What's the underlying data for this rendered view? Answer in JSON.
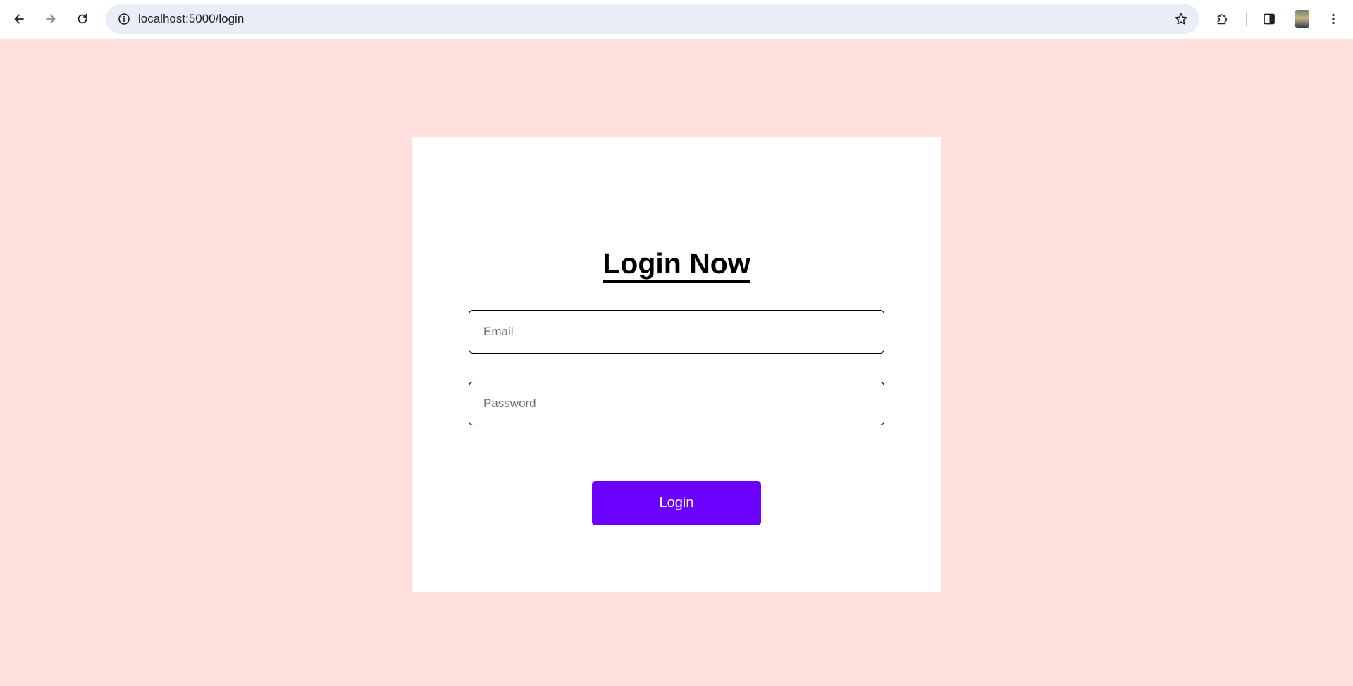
{
  "browser": {
    "url": "localhost:5000/login",
    "icons": {
      "back": "back-arrow-icon",
      "forward": "forward-arrow-icon",
      "reload": "reload-icon",
      "site_info": "info-icon",
      "bookmark": "star-icon",
      "extensions": "puzzle-icon",
      "side_panel": "side-panel-icon",
      "menu": "kebab-menu-icon"
    }
  },
  "page": {
    "background_color": "#ffe0dc",
    "title": "Login Now",
    "email_placeholder": "Email",
    "password_placeholder": "Password",
    "login_label": "Login",
    "accent_color": "#6b00ff"
  }
}
